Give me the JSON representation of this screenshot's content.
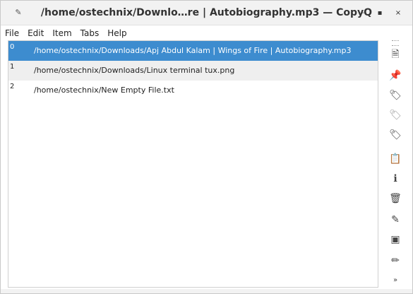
{
  "window": {
    "title": "/home/ostechnix/Downlo…re  |  Autobiography.mp3 — CopyQ",
    "buttons": {
      "minimize": "-",
      "maximize": "▪",
      "close": "×"
    }
  },
  "menu": {
    "file": "File",
    "edit": "Edit",
    "item": "Item",
    "tabs": "Tabs",
    "help": "Help"
  },
  "items": [
    {
      "index": "0",
      "text": "/home/ostechnix/Downloads/Apj Abdul Kalam  |  Wings of Fire  |  Autobiography.mp3",
      "selected": true
    },
    {
      "index": "1",
      "text": "/home/ostechnix/Downloads/Linux terminal tux.png"
    },
    {
      "index": "2",
      "text": "/home/ostechnix/New Empty File.txt"
    }
  ],
  "toolbar_icons": [
    "new-item-icon",
    "pin-icon",
    "tag-icon",
    "tag-light-icon",
    "tag-dark-icon",
    "paste-icon",
    "info-icon",
    "trash-icon",
    "edit-external-icon",
    "edit-notes-icon",
    "pencil-icon",
    "more-chevron-icon"
  ],
  "colors": {
    "selection": "#3d8ccf"
  }
}
